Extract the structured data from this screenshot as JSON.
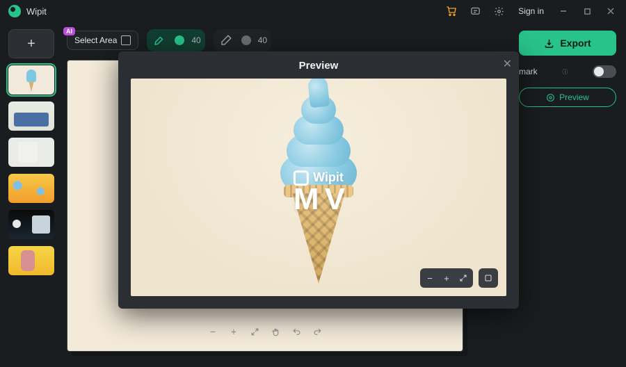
{
  "app": {
    "title": "Wipit"
  },
  "titlebar": {
    "signin": "Sign in"
  },
  "toolbar": {
    "select_area": "Select Area",
    "ai_badge": "AI",
    "brush_size": "40",
    "eraser_size": "40"
  },
  "rightpanel": {
    "export": "Export",
    "watermark_label": "mark",
    "preview": "Preview"
  },
  "modal": {
    "title": "Preview",
    "watermark_brand": "Wipit",
    "watermark_big": "M   V"
  },
  "thumbnails": [
    {
      "id": "ice-cream",
      "active": true
    },
    {
      "id": "living-room",
      "active": false
    },
    {
      "id": "tshirt",
      "active": false
    },
    {
      "id": "flowers",
      "active": false
    },
    {
      "id": "astronaut",
      "active": false
    },
    {
      "id": "girl-yellow",
      "active": false
    }
  ]
}
